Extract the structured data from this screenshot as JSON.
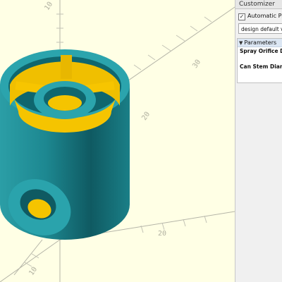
{
  "customizer": {
    "title": "Customizer",
    "auto_preview_label": "Automatic Preview",
    "preset_select_value": "design default values",
    "parameters_header": "Parameters",
    "params": [
      {
        "label": "Spray Orifice Diameter"
      },
      {
        "label": "Can Stem Diameter"
      }
    ]
  },
  "viewport": {
    "background_color": "#ffffe5",
    "model_side_color": "#1a7f87",
    "model_top_color": "#2ba4ad",
    "model_inner_color": "#f5c400",
    "ruler_labels": [
      "30",
      "20",
      "10",
      "20",
      "10"
    ]
  }
}
